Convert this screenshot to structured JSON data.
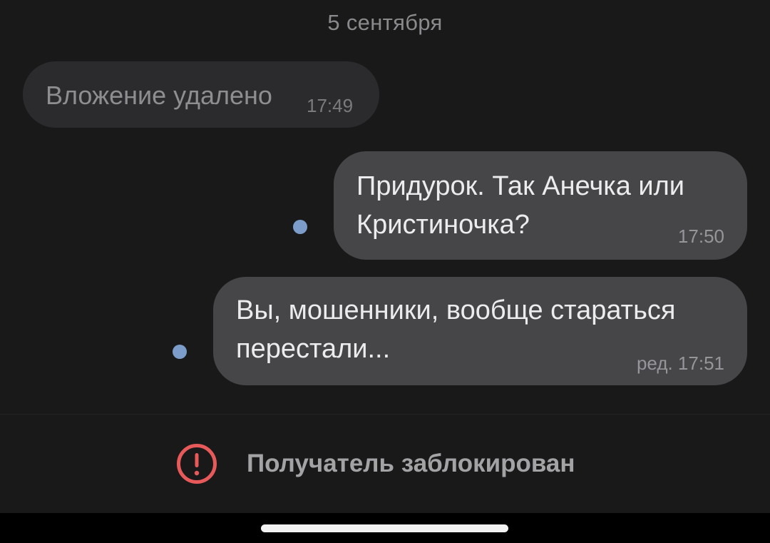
{
  "chat": {
    "date_separator": "5 сентября",
    "messages": [
      {
        "direction": "incoming",
        "text": "Вложение удалено",
        "time": "17:49"
      },
      {
        "direction": "outgoing",
        "lines": [
          "Придурок. Так Анечка или",
          "Кристиночка?"
        ],
        "time": "17:50",
        "unread_dot": true
      },
      {
        "direction": "outgoing",
        "lines": [
          "Вы, мошенники, вообще стараться",
          "перестали..."
        ],
        "time": "ред. 17:51",
        "unread_dot": true
      }
    ]
  },
  "footer": {
    "icon": "alert-circle-icon",
    "blocked_text": "Получатель заблокирован"
  },
  "colors": {
    "background": "#19191a",
    "incoming_bubble": "#2b2b2d",
    "outgoing_bubble": "#464649",
    "unread_dot": "#7c9dc9",
    "alert_red": "#e85a5a"
  }
}
